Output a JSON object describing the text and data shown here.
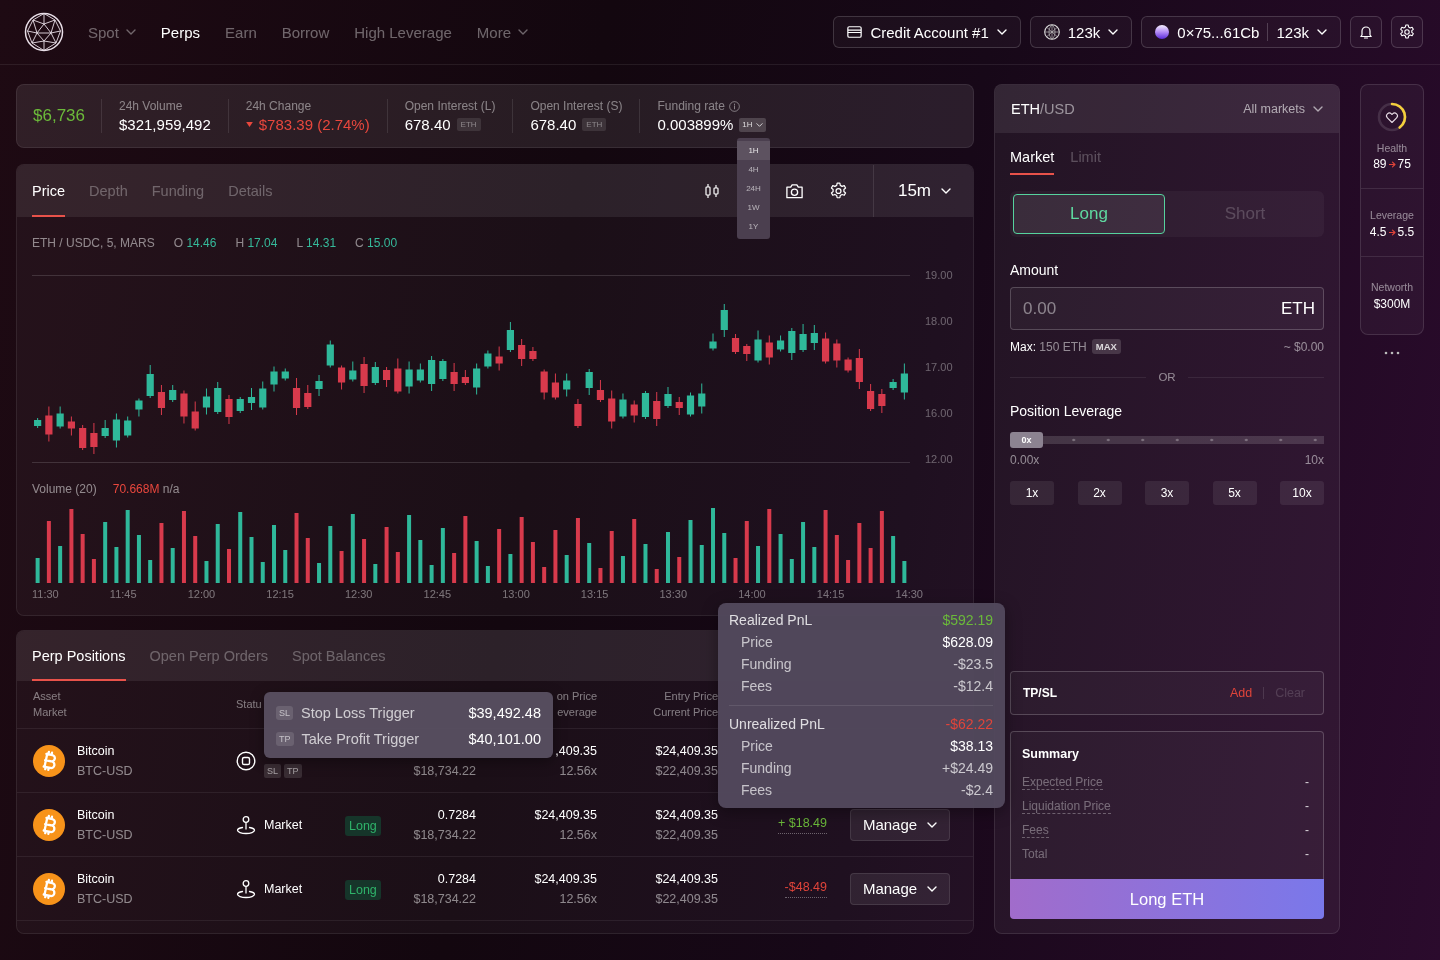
{
  "nav": {
    "items": [
      {
        "label": "Spot",
        "selected": false,
        "dropdown": true
      },
      {
        "label": "Perps",
        "selected": true,
        "dropdown": false
      },
      {
        "label": "Earn",
        "selected": false,
        "dropdown": false
      },
      {
        "label": "Borrow",
        "selected": false,
        "dropdown": false
      },
      {
        "label": "High Leverage",
        "selected": false,
        "dropdown": false
      },
      {
        "label": "More",
        "selected": false,
        "dropdown": true
      }
    ]
  },
  "account_menu": {
    "account": "Credit Account #1",
    "balance": "123k",
    "wallet_address": "0×75...61Cb",
    "wallet_balance": "123k"
  },
  "market_stats": {
    "price": "$6,736",
    "stats": [
      {
        "kind": "plain",
        "label": "24h Volume",
        "value": "$321,959,492"
      },
      {
        "kind": "loss",
        "label": "24h Change",
        "value": "$783.39 (2.74%)"
      },
      {
        "kind": "plain",
        "label": "Open Interest (L)",
        "value": "678.40",
        "unit": "ETH"
      },
      {
        "kind": "plain",
        "label": "Open Interest (S)",
        "value": "678.40",
        "unit": "ETH"
      },
      {
        "kind": "plain",
        "label": "Funding rate",
        "value": "0.003899%",
        "info": true,
        "interval": {
          "label": "1H",
          "expanded": true,
          "options": [
            {
              "label": "1H",
              "selected": true
            },
            {
              "label": "4H",
              "selected": false
            },
            {
              "label": "24H",
              "selected": false
            },
            {
              "label": "1W",
              "selected": false
            },
            {
              "label": "1Y",
              "selected": false
            }
          ]
        }
      }
    ]
  },
  "chart": {
    "tabs": [
      {
        "label": "Price",
        "selected": true
      },
      {
        "label": "Depth",
        "selected": false
      },
      {
        "label": "Funding",
        "selected": false
      },
      {
        "label": "Details",
        "selected": false
      }
    ],
    "timeframe": "15m",
    "legend": {
      "pair": "ETH / USDC, 5, MARS",
      "ohlc": [
        {
          "key": "O",
          "value": "14.46"
        },
        {
          "key": "H",
          "value": "17.04"
        },
        {
          "key": "L",
          "value": "14.31"
        },
        {
          "key": "C",
          "value": "15.00"
        }
      ]
    },
    "y_axis_labels": [
      "19.00",
      "18.00",
      "17.00",
      "16.00",
      "12.00"
    ],
    "volume": {
      "label": "Volume (20)",
      "value": "70.668M",
      "extra": "n/a"
    },
    "x_axis_labels": [
      "11:30",
      "11:45",
      "12:00",
      "12:15",
      "12:30",
      "12:45",
      "13:00",
      "13:15",
      "13:30",
      "14:00",
      "14:15",
      "14:30"
    ]
  },
  "positions": {
    "tabs": [
      {
        "label": "Perp Positions",
        "selected": true
      },
      {
        "label": "Open Perp Orders",
        "selected": false
      },
      {
        "label": "Spot Balances",
        "selected": false
      }
    ],
    "header": {
      "column_1": {
        "top": "Asset",
        "bottom": "Market"
      },
      "column_2": {
        "top": "Statu"
      },
      "column_5": {
        "top": "on Price",
        "bottom": "everage"
      },
      "column_6": {
        "top": "Entry Price",
        "bottom": "Current Price"
      }
    },
    "rows": [
      {
        "asset": "Bitcoin",
        "market": "BTC-USD",
        "status": {
          "kind": "trigger",
          "tags": [
            "SL",
            "TP"
          ]
        },
        "value": "$18,734.22",
        "liq_price": ",409.35",
        "leverage": "12.56x",
        "entry_price": "$24,409.35",
        "current_price": "$22,409.35"
      },
      {
        "asset": "Bitcoin",
        "market": "BTC-USD",
        "status": {
          "kind": "market",
          "label": "Market"
        },
        "side": "Long",
        "size": "0.7284",
        "value": "$18,734.22",
        "liq_price": "$24,409.35",
        "leverage": "12.56x",
        "entry_price": "$24,409.35",
        "current_price": "$22,409.35",
        "pnl": {
          "value": "+ $18.49",
          "kind": "gain"
        },
        "action": "Manage"
      },
      {
        "asset": "Bitcoin",
        "market": "BTC-USD",
        "status": {
          "kind": "market",
          "label": "Market"
        },
        "side": "Long",
        "size": "0.7284",
        "value": "$18,734.22",
        "liq_price": "$24,409.35",
        "leverage": "12.56x",
        "entry_price": "$24,409.35",
        "current_price": "$22,409.35",
        "pnl": {
          "value": "-$48.49",
          "kind": "loss"
        },
        "action": "Manage"
      }
    ]
  },
  "trigger_tooltip": {
    "items": [
      {
        "tag": "SL",
        "label": "Stop Loss Trigger",
        "value": "$39,492.48"
      },
      {
        "tag": "TP",
        "label": "Take Profit Trigger",
        "value": "$40,101.00"
      }
    ]
  },
  "pnl_tooltip": {
    "sections": [
      {
        "kind": "gain",
        "label": "Realized PnL",
        "value": "$592.19",
        "items": [
          {
            "label": "Price",
            "value": "$628.09",
            "muted": false
          },
          {
            "label": "Funding",
            "value": "-$23.5",
            "muted": true
          },
          {
            "label": "Fees",
            "value": "-$12.4",
            "muted": true
          }
        ]
      },
      {
        "kind": "loss",
        "label": "Unrealized PnL",
        "value": "-$62.22",
        "items": [
          {
            "label": "Price",
            "value": "$38.13",
            "muted": false
          },
          {
            "label": "Funding",
            "value": "+$24.49",
            "muted": true
          },
          {
            "label": "Fees",
            "value": "-$2.4",
            "muted": true
          }
        ]
      }
    ]
  },
  "order_form": {
    "pair": {
      "base": "ETH",
      "quote": "/USD"
    },
    "markets_label": "All markets",
    "tabs": [
      {
        "label": "Market",
        "selected": true
      },
      {
        "label": "Limit",
        "selected": false
      }
    ],
    "sides": [
      {
        "label": "Long",
        "kind": "long",
        "selected": true
      },
      {
        "label": "Short",
        "kind": "short",
        "selected": false
      }
    ],
    "amount": {
      "label": "Amount",
      "placeholder": "0.00",
      "unit": "ETH"
    },
    "max": {
      "label": "Max:",
      "value": "150 ETH",
      "button": "MAX"
    },
    "usd_estimate": "~ $0.00",
    "or_label": "OR",
    "leverage": {
      "label": "Position Leverage",
      "level": 0,
      "thumb": "0x",
      "min_label": "0.00x",
      "max_label": "10x",
      "presets": [
        "1x",
        "2x",
        "3x",
        "5x",
        "10x"
      ]
    },
    "tpsl": {
      "label": "TP/SL",
      "add": "Add",
      "clear": "Clear",
      "clear_disabled": true
    },
    "summary": {
      "title": "Summary",
      "rows": [
        {
          "label": "Expected Price",
          "value": "-",
          "hint": true
        },
        {
          "label": "Liquidation Price",
          "value": "-",
          "hint": true
        },
        {
          "label": "Fees",
          "value": "-",
          "hint": true
        },
        {
          "label": "Total",
          "value": "-",
          "hint": false
        }
      ]
    },
    "submit": "Long ETH"
  },
  "account_summary": {
    "metrics": [
      {
        "kind": "gauge",
        "label": "Health",
        "from": "89",
        "to": "75",
        "level": 0.4
      },
      {
        "kind": "change",
        "label": "Leverage",
        "from": "4.5",
        "to": "5.5"
      },
      {
        "kind": "value",
        "label": "Networth",
        "value": "$300M"
      }
    ]
  }
}
